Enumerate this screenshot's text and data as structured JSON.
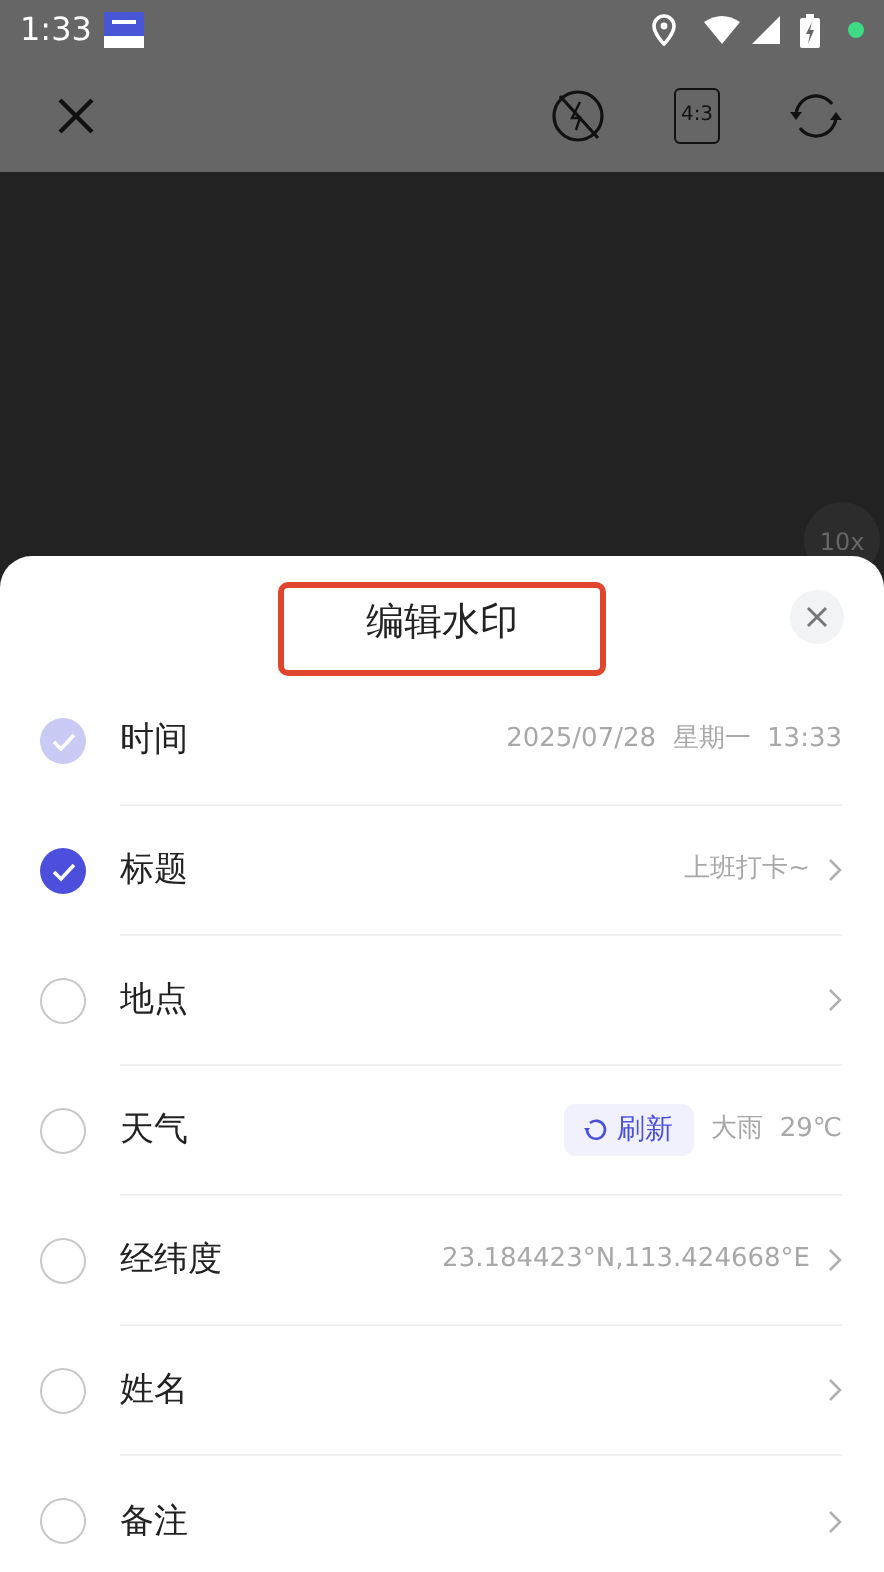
{
  "status_bar": {
    "time": "1:33"
  },
  "camera_toolbar": {
    "zoom_label": "10x",
    "ratio_label": "4:3"
  },
  "sheet": {
    "title": "编辑水印",
    "title_highlighted": true,
    "items": [
      {
        "label": "时间",
        "checked": true,
        "disabled": true,
        "value": "2025/07/28  星期一  13:33",
        "chevron": false
      },
      {
        "label": "标题",
        "checked": true,
        "disabled": false,
        "value": "上班打卡~",
        "chevron": true
      },
      {
        "label": "地点",
        "checked": false,
        "disabled": false,
        "chevron": true
      },
      {
        "label": "天气",
        "checked": false,
        "disabled": false,
        "refresh_button": "刷新",
        "value": "大雨  29℃",
        "chevron": false
      },
      {
        "label": "经纬度",
        "checked": false,
        "disabled": false,
        "value": "23.184423°N,113.424668°E",
        "chevron": true
      },
      {
        "label": "姓名",
        "checked": false,
        "disabled": false,
        "chevron": true
      },
      {
        "label": "备注",
        "checked": false,
        "disabled": false,
        "chevron": true
      }
    ]
  }
}
